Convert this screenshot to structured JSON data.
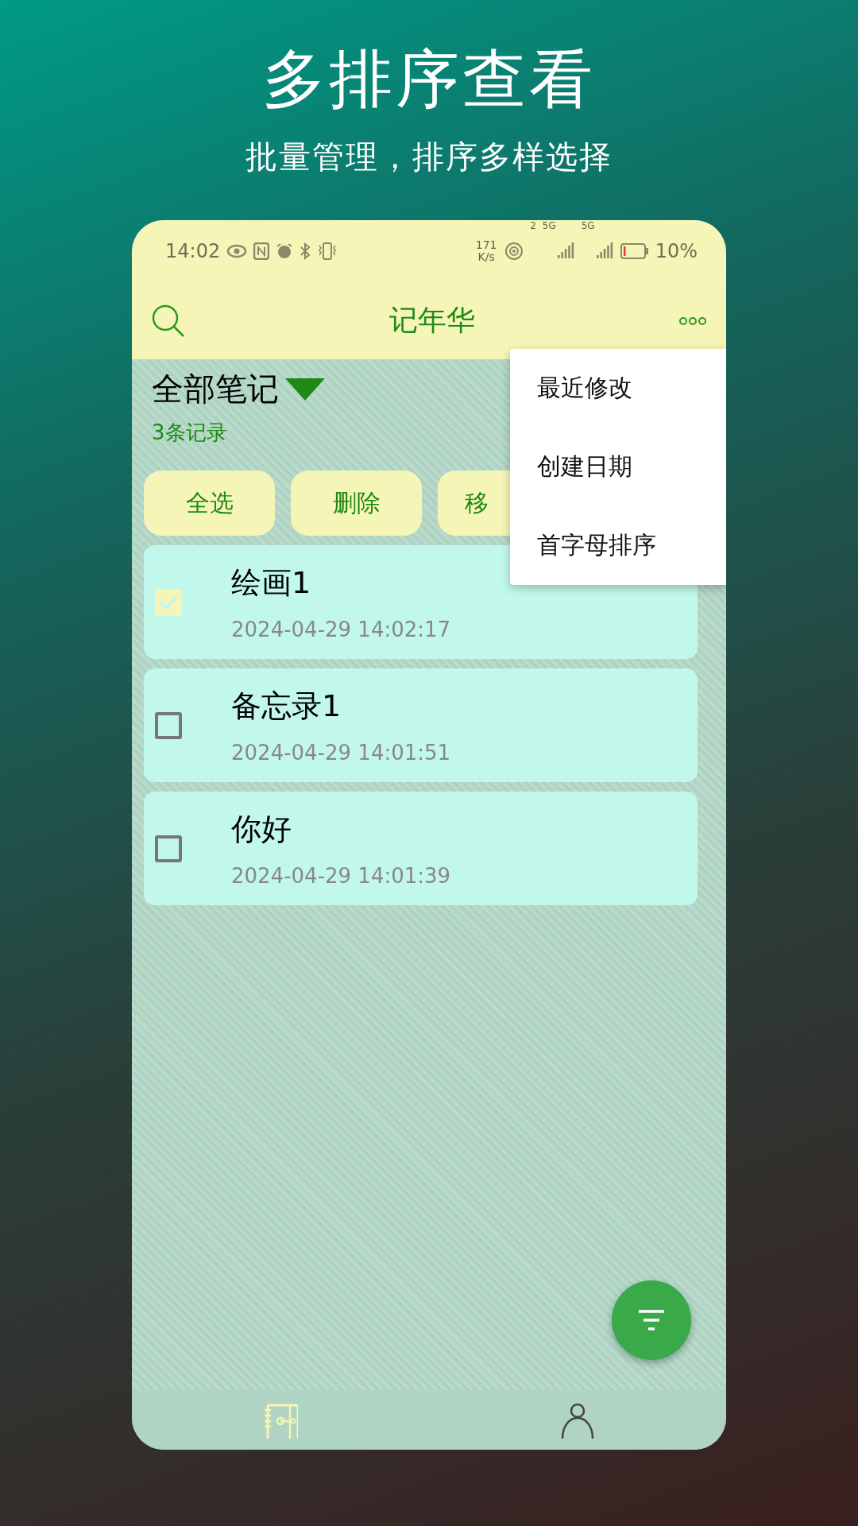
{
  "headline": "多排序查看",
  "subheadline": "批量管理，排序多样选择",
  "status_bar": {
    "time": "14:02",
    "speed": "171 K/s",
    "signals": [
      {
        "label": "5G",
        "hotspot_number": "2"
      },
      {
        "label": "5G"
      }
    ],
    "battery": {
      "level": 0.1,
      "text": "10%"
    }
  },
  "app_bar": {
    "title": "记年华"
  },
  "folder": {
    "title": "全部笔记",
    "count": "3条记录"
  },
  "actions": [
    "全选",
    "删除",
    "移"
  ],
  "notes": [
    {
      "title": "绘画1",
      "date": "2024-04-29 14:02:17",
      "checked": true
    },
    {
      "title": "备忘录1",
      "date": "2024-04-29 14:01:51",
      "checked": false
    },
    {
      "title": "你好",
      "date": "2024-04-29 14:01:39",
      "checked": false
    }
  ],
  "sort_menu": [
    "最近修改",
    "创建日期",
    "首字母排序"
  ],
  "bottom_nav": [
    {
      "kind": "notes",
      "selected": true
    },
    {
      "kind": "profile",
      "selected": false
    }
  ]
}
